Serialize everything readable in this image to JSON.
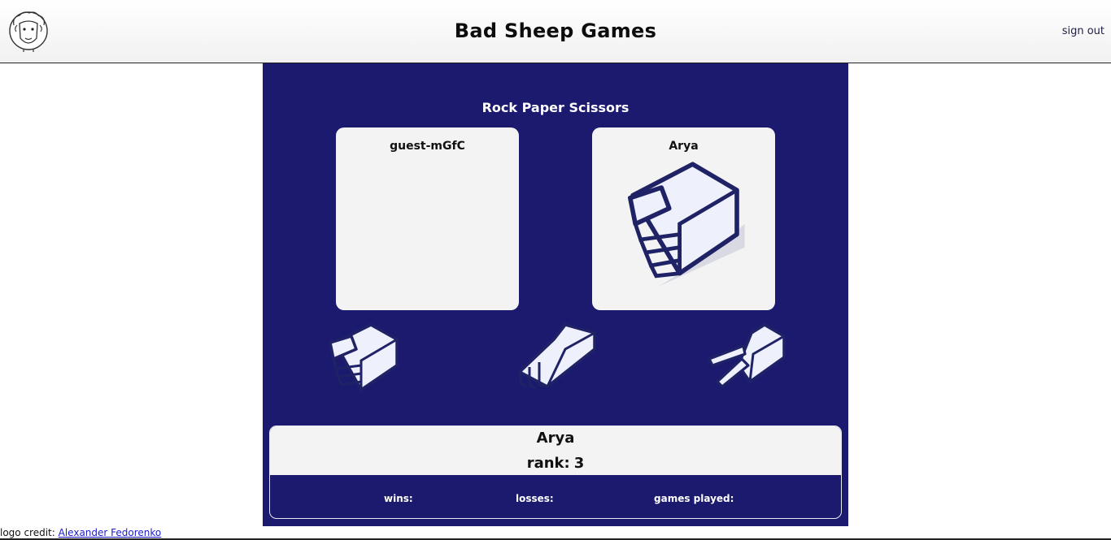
{
  "header": {
    "site_title": "Bad Sheep Games",
    "sign_out_label": "sign out",
    "logo_icon": "sheep-logo-icon"
  },
  "game": {
    "title": "Rock Paper Scissors",
    "players": [
      {
        "name": "guest-mGfC",
        "choice_icon": ""
      },
      {
        "name": "Arya",
        "choice_icon": "rock-hand-icon"
      }
    ],
    "choices": [
      {
        "icon": "rock-hand-icon"
      },
      {
        "icon": "paper-hand-icon"
      },
      {
        "icon": "scissors-hand-icon"
      }
    ]
  },
  "stats": {
    "name": "Arya",
    "rank_label": "rank:",
    "rank_value": "3",
    "wins_label": "wins:",
    "losses_label": "losses:",
    "games_played_label": "games played:"
  },
  "footer": {
    "credit_label": "logo credit:",
    "credit_link": "Alexander Fedorenko"
  },
  "colors": {
    "panel": "#1b1a6e",
    "card": "#f3f3f3",
    "hand_fill": "#eef0fc",
    "hand_outline": "#1f2366"
  }
}
